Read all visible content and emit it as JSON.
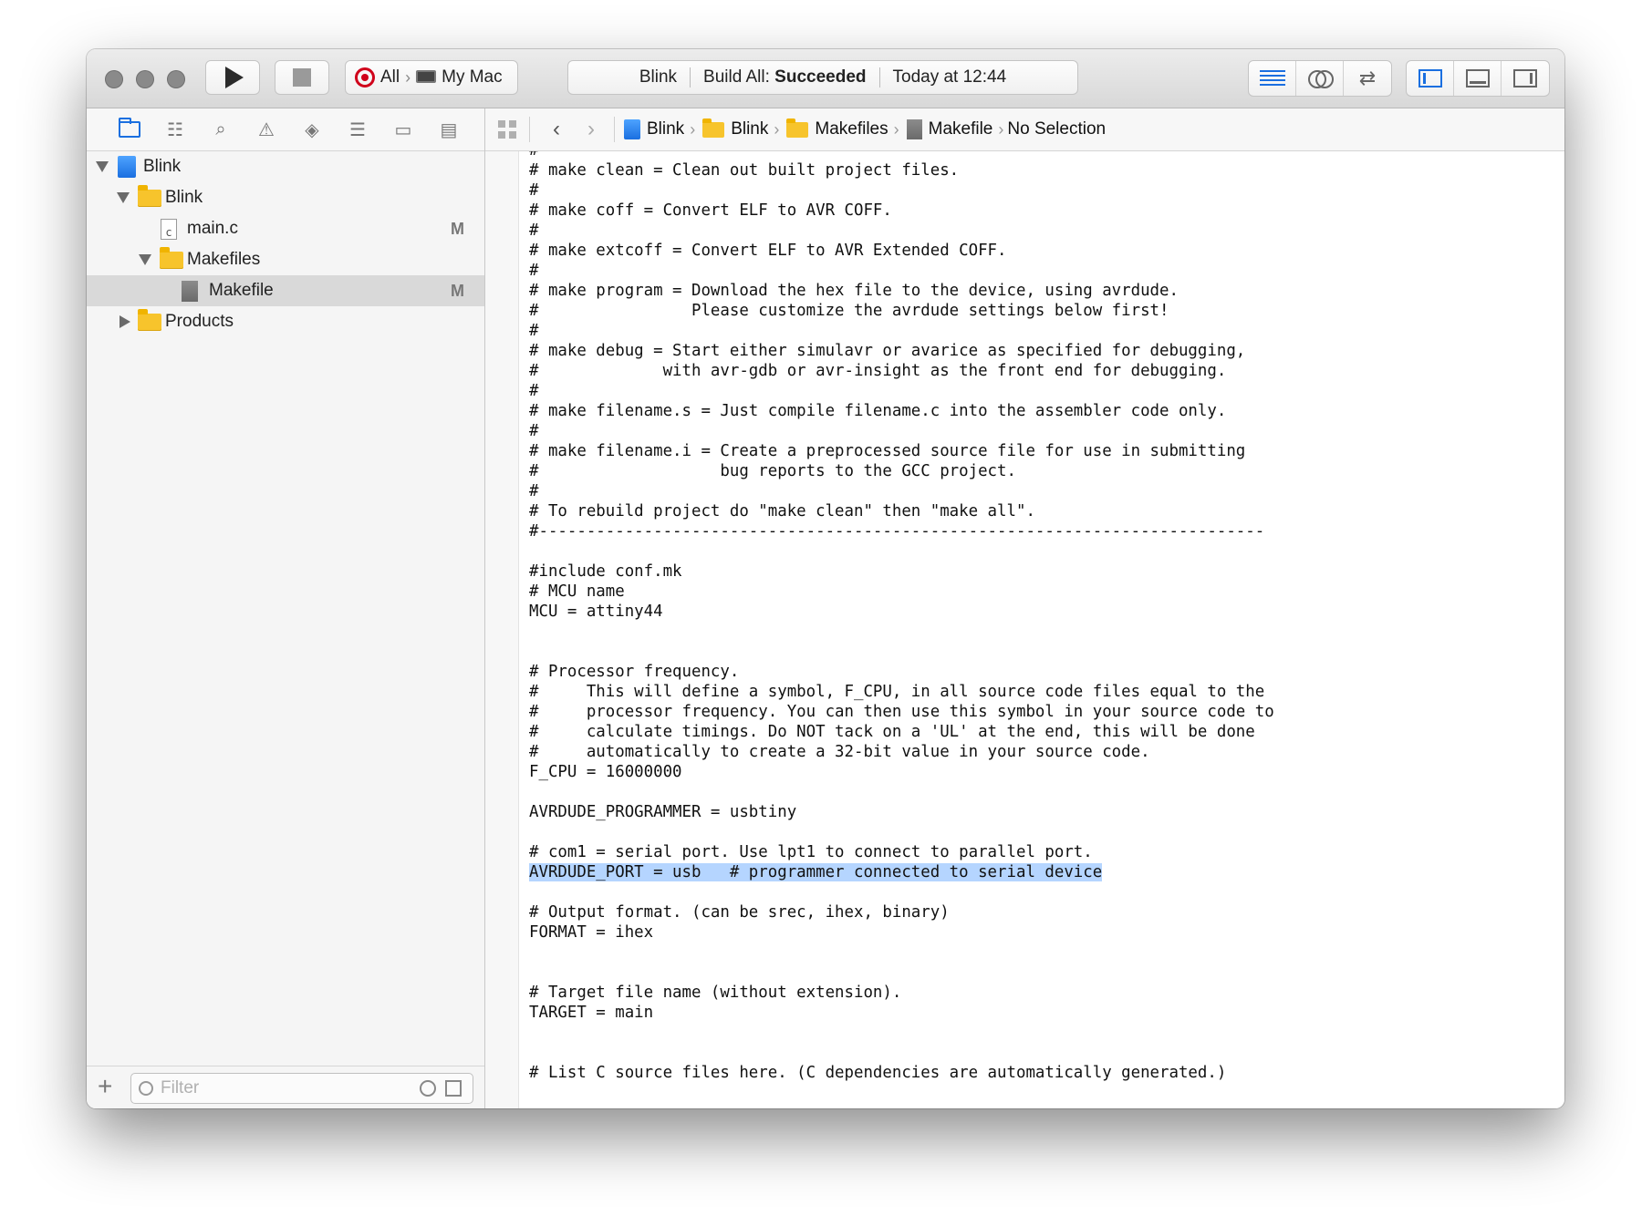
{
  "toolbar": {
    "scheme_name": "All",
    "destination": "My Mac",
    "status_project": "Blink",
    "status_action": "Build All:",
    "status_result": "Succeeded",
    "status_time": "Today at 12:44"
  },
  "navigator": {
    "tree": [
      {
        "label": "Blink"
      },
      {
        "label": "Blink"
      },
      {
        "label": "main.c",
        "badge": "M"
      },
      {
        "label": "Makefiles"
      },
      {
        "label": "Makefile",
        "badge": "M"
      },
      {
        "label": "Products"
      }
    ],
    "filter_placeholder": "Filter"
  },
  "jumpbar": {
    "crumbs": [
      "Blink",
      "Blink",
      "Makefiles",
      "Makefile"
    ],
    "selection": "No Selection"
  },
  "editor": {
    "lines": [
      "#",
      "# make clean = Clean out built project files.",
      "#",
      "# make coff = Convert ELF to AVR COFF.",
      "#",
      "# make extcoff = Convert ELF to AVR Extended COFF.",
      "#",
      "# make program = Download the hex file to the device, using avrdude.",
      "#                Please customize the avrdude settings below first!",
      "#",
      "# make debug = Start either simulavr or avarice as specified for debugging,",
      "#             with avr-gdb or avr-insight as the front end for debugging.",
      "#",
      "# make filename.s = Just compile filename.c into the assembler code only.",
      "#",
      "# make filename.i = Create a preprocessed source file for use in submitting",
      "#                   bug reports to the GCC project.",
      "#",
      "# To rebuild project do \"make clean\" then \"make all\".",
      "#----------------------------------------------------------------------------",
      "",
      "#include conf.mk",
      "# MCU name",
      "MCU = attiny44",
      "",
      "",
      "# Processor frequency.",
      "#     This will define a symbol, F_CPU, in all source code files equal to the",
      "#     processor frequency. You can then use this symbol in your source code to",
      "#     calculate timings. Do NOT tack on a 'UL' at the end, this will be done",
      "#     automatically to create a 32-bit value in your source code.",
      "F_CPU = 16000000",
      "",
      "AVRDUDE_PROGRAMMER = usbtiny",
      "",
      "# com1 = serial port. Use lpt1 to connect to parallel port.",
      "AVRDUDE_PORT = usb   # programmer connected to serial device",
      "",
      "# Output format. (can be srec, ihex, binary)",
      "FORMAT = ihex",
      "",
      "",
      "# Target file name (without extension).",
      "TARGET = main",
      "",
      "",
      "# List C source files here. (C dependencies are automatically generated.)"
    ],
    "highlighted_line": 36
  }
}
